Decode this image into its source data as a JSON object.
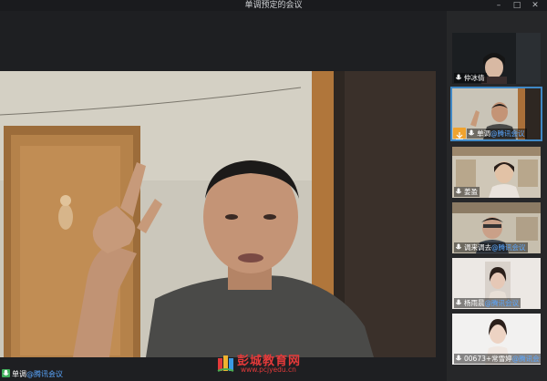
{
  "window": {
    "title": "单调预定的会议",
    "minimize": "–",
    "maximize": "□",
    "close": "✕"
  },
  "main_speaker": {
    "name": "单调",
    "app": "@腾讯会议"
  },
  "participants": [
    {
      "name": "仲冰倩",
      "app": "",
      "active": false
    },
    {
      "name": "单调",
      "app": "@腾讯会议",
      "active": true
    },
    {
      "name": "姜盈",
      "app": "",
      "active": false
    },
    {
      "name": "调来调去",
      "app": "@腾讯会议",
      "active": false
    },
    {
      "name": "杨雨晨",
      "app": "@腾讯会议",
      "active": false
    },
    {
      "name": "00673+常雪婷",
      "app": "@腾讯会议",
      "active": false
    }
  ],
  "watermark": {
    "text": "彭城教育网",
    "url": "www.pcjyedu.cn"
  },
  "icons": {
    "mic": "microphone-icon",
    "camera": "camera-icon",
    "logo": "books-logo-icon"
  },
  "colors": {
    "accent": "#3f88c5",
    "brand": "#5aa7ff",
    "watermark": "#e43a3a"
  }
}
